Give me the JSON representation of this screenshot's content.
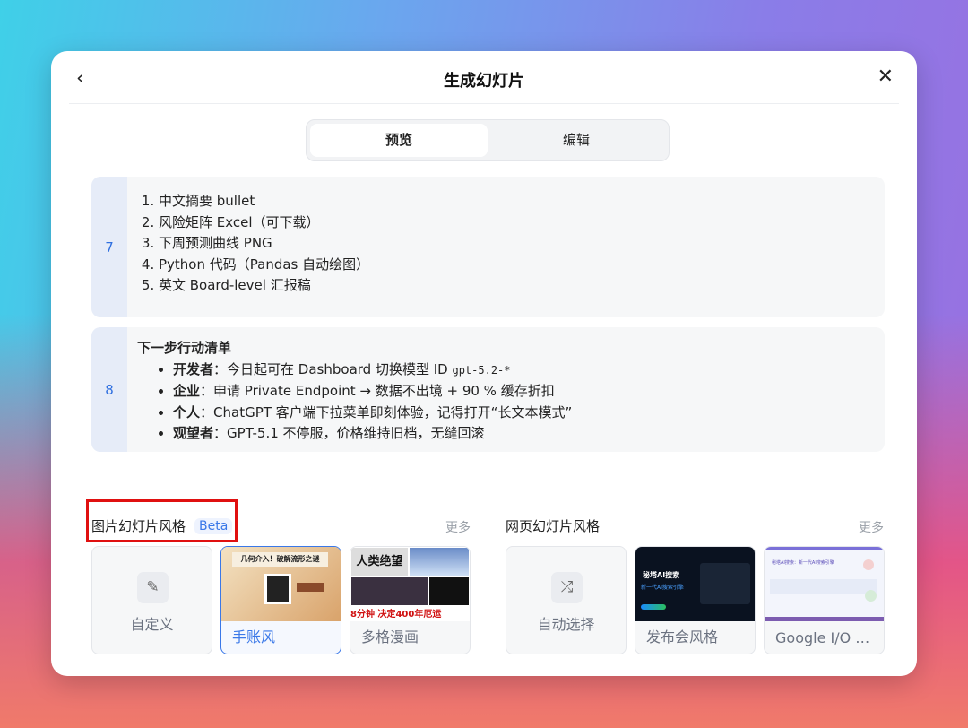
{
  "header": {
    "title": "生成幻灯片",
    "back_icon": "‹",
    "close_icon": "✕"
  },
  "tabs": [
    {
      "label": "预览",
      "active": true
    },
    {
      "label": "编辑",
      "active": false
    }
  ],
  "slides": [
    {
      "number": "7",
      "items": [
        "中文摘要 bullet",
        "风险矩阵 Excel（可下载）",
        "下周预测曲线 PNG",
        "Python 代码（Pandas 自动绘图）",
        "英文 Board-level 汇报稿"
      ]
    },
    {
      "number": "8",
      "heading": "下一步行动清单",
      "bullets": [
        {
          "role": "开发者",
          "sep": "：",
          "text": "今日起可在 Dashboard 切换模型 ID ",
          "code": "gpt-5.2-*"
        },
        {
          "role": "企业",
          "sep": "：",
          "text": "申请 Private Endpoint → 数据不出境 + 90 % 缓存折扣"
        },
        {
          "role": "个人",
          "sep": "：",
          "text": "ChatGPT 客户端下拉菜单即刻体验，记得打开“长文本模式”"
        },
        {
          "role": "观望者",
          "sep": "：",
          "text": "GPT-5.1 不停服，价格维持旧档，无缝回滚"
        }
      ]
    }
  ],
  "image_styles": {
    "title": "图片幻灯片风格",
    "badge": "Beta",
    "more": "更多",
    "cards": [
      {
        "label": "自定义",
        "icon": "pencil"
      },
      {
        "label": "手账风",
        "selected": true,
        "thumb_text": "几何介入！破解流形之谜"
      },
      {
        "label": "多格漫画",
        "thumb_text": "人类绝望",
        "thumb_caption": "8分钟 决定400年厄运"
      }
    ]
  },
  "web_styles": {
    "title": "网页幻灯片风格",
    "more": "更多",
    "cards": [
      {
        "label": "自动选择",
        "icon": "shuffle"
      },
      {
        "label": "发布会风格",
        "thumb_text": "秘塔AI搜索",
        "thumb_sub": "新一代AI搜索引擎"
      },
      {
        "label": "Google I/O …",
        "thumb_text": "秘塔AI搜索：新一代AI搜索引擎"
      }
    ]
  },
  "colors": {
    "accent": "#3a78e8",
    "highlight": "#e01010"
  }
}
